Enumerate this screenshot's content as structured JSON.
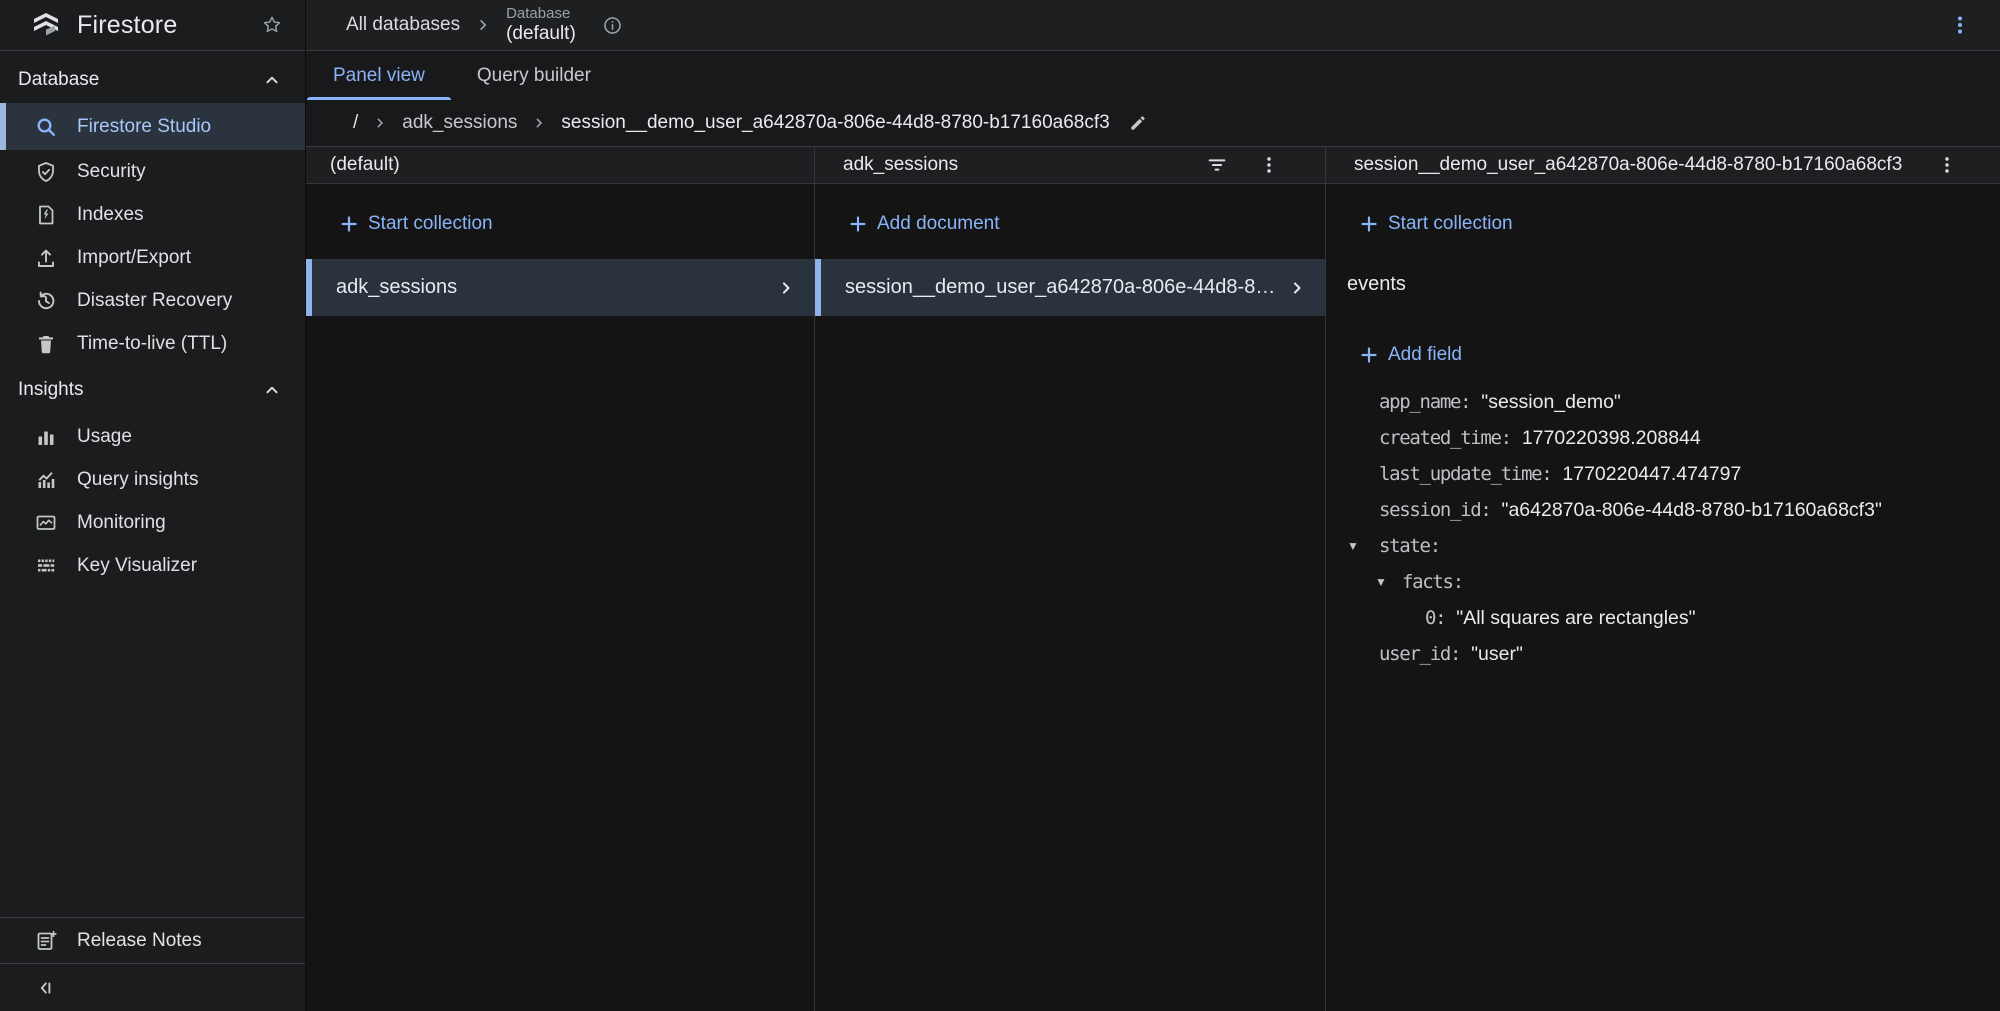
{
  "app": {
    "title": "Firestore"
  },
  "topbar": {
    "all_databases": "All databases",
    "database_label": "Database",
    "database_name": "(default)"
  },
  "tabs": {
    "panel_view": "Panel view",
    "query_builder": "Query builder"
  },
  "sidebar": {
    "database_section": {
      "label": "Database"
    },
    "insights_section": {
      "label": "Insights"
    },
    "database_items": [
      {
        "label": "Firestore Studio"
      },
      {
        "label": "Security"
      },
      {
        "label": "Indexes"
      },
      {
        "label": "Import/Export"
      },
      {
        "label": "Disaster Recovery"
      },
      {
        "label": "Time-to-live (TTL)"
      }
    ],
    "insights_items": [
      {
        "label": "Usage"
      },
      {
        "label": "Query insights"
      },
      {
        "label": "Monitoring"
      },
      {
        "label": "Key Visualizer"
      }
    ],
    "release_notes": "Release Notes"
  },
  "breadcrumb": {
    "root": "/",
    "collection": "adk_sessions",
    "document": "session__demo_user_a642870a-806e-44d8-8780-b17160a68cf3"
  },
  "panels": {
    "database": {
      "title": "(default)",
      "action": "Start collection",
      "selected_row": "adk_sessions"
    },
    "collection": {
      "title": "adk_sessions",
      "action": "Add document",
      "selected_row": "session__demo_user_a642870a-806e-44d8-8780-..."
    },
    "document": {
      "title": "session__demo_user_a642870a-806e-44d8-8780-b17160a68cf3",
      "start_collection": "Start collection",
      "subcollection": "events",
      "add_field": "Add field",
      "fields": [
        {
          "key": "app_name:",
          "value": "\"session_demo\""
        },
        {
          "key": "created_time:",
          "value": "1770220398.208844"
        },
        {
          "key": "last_update_time:",
          "value": "1770220447.474797"
        },
        {
          "key": "session_id:",
          "value": "\"a642870a-806e-44d8-8780-b17160a68cf3\""
        },
        {
          "key": "state:",
          "value": ""
        },
        {
          "key": "facts:",
          "value": ""
        },
        {
          "key": "0:",
          "value": "\"All squares are rectangles\""
        },
        {
          "key": "user_id:",
          "value": "\"user\""
        }
      ]
    }
  },
  "colors": {
    "accent": "#8ab4f8",
    "selection_bg": "#2a323e",
    "sidebar_selection_bar": "#9db8dd"
  }
}
